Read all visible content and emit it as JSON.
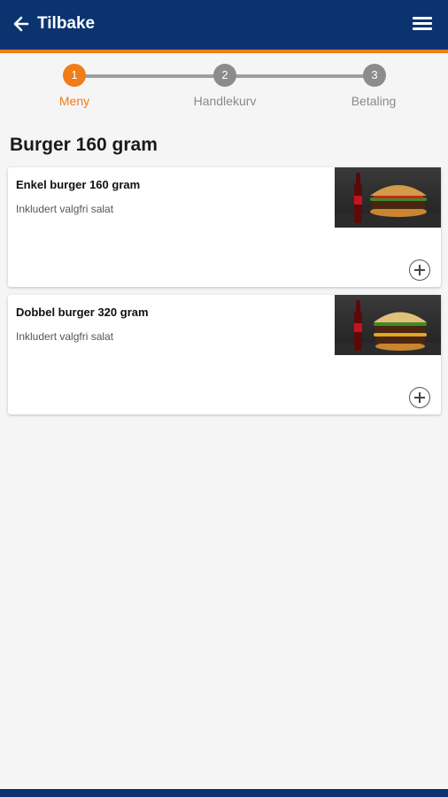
{
  "header": {
    "back_label": "Tilbake",
    "back_icon": "arrow-left-icon",
    "menu_icon": "hamburger-menu-icon"
  },
  "steps": [
    {
      "number": "1",
      "label": "Meny",
      "active": true
    },
    {
      "number": "2",
      "label": "Handlekurv",
      "active": false
    },
    {
      "number": "3",
      "label": "Betaling",
      "active": false
    }
  ],
  "section": {
    "title": "Burger 160 gram"
  },
  "products": [
    {
      "name": "Enkel burger 160 gram",
      "description": "Inkludert valgfri salat",
      "image": "burger-with-cola-photo"
    },
    {
      "name": "Dobbel burger 320 gram",
      "description": "Inkludert valgfri salat",
      "image": "double-burger-with-cola-photo"
    }
  ],
  "colors": {
    "header_bg": "#0a3370",
    "accent": "#f07c1a",
    "inactive_step": "#8c8c8c",
    "background": "#f5f5f5"
  }
}
